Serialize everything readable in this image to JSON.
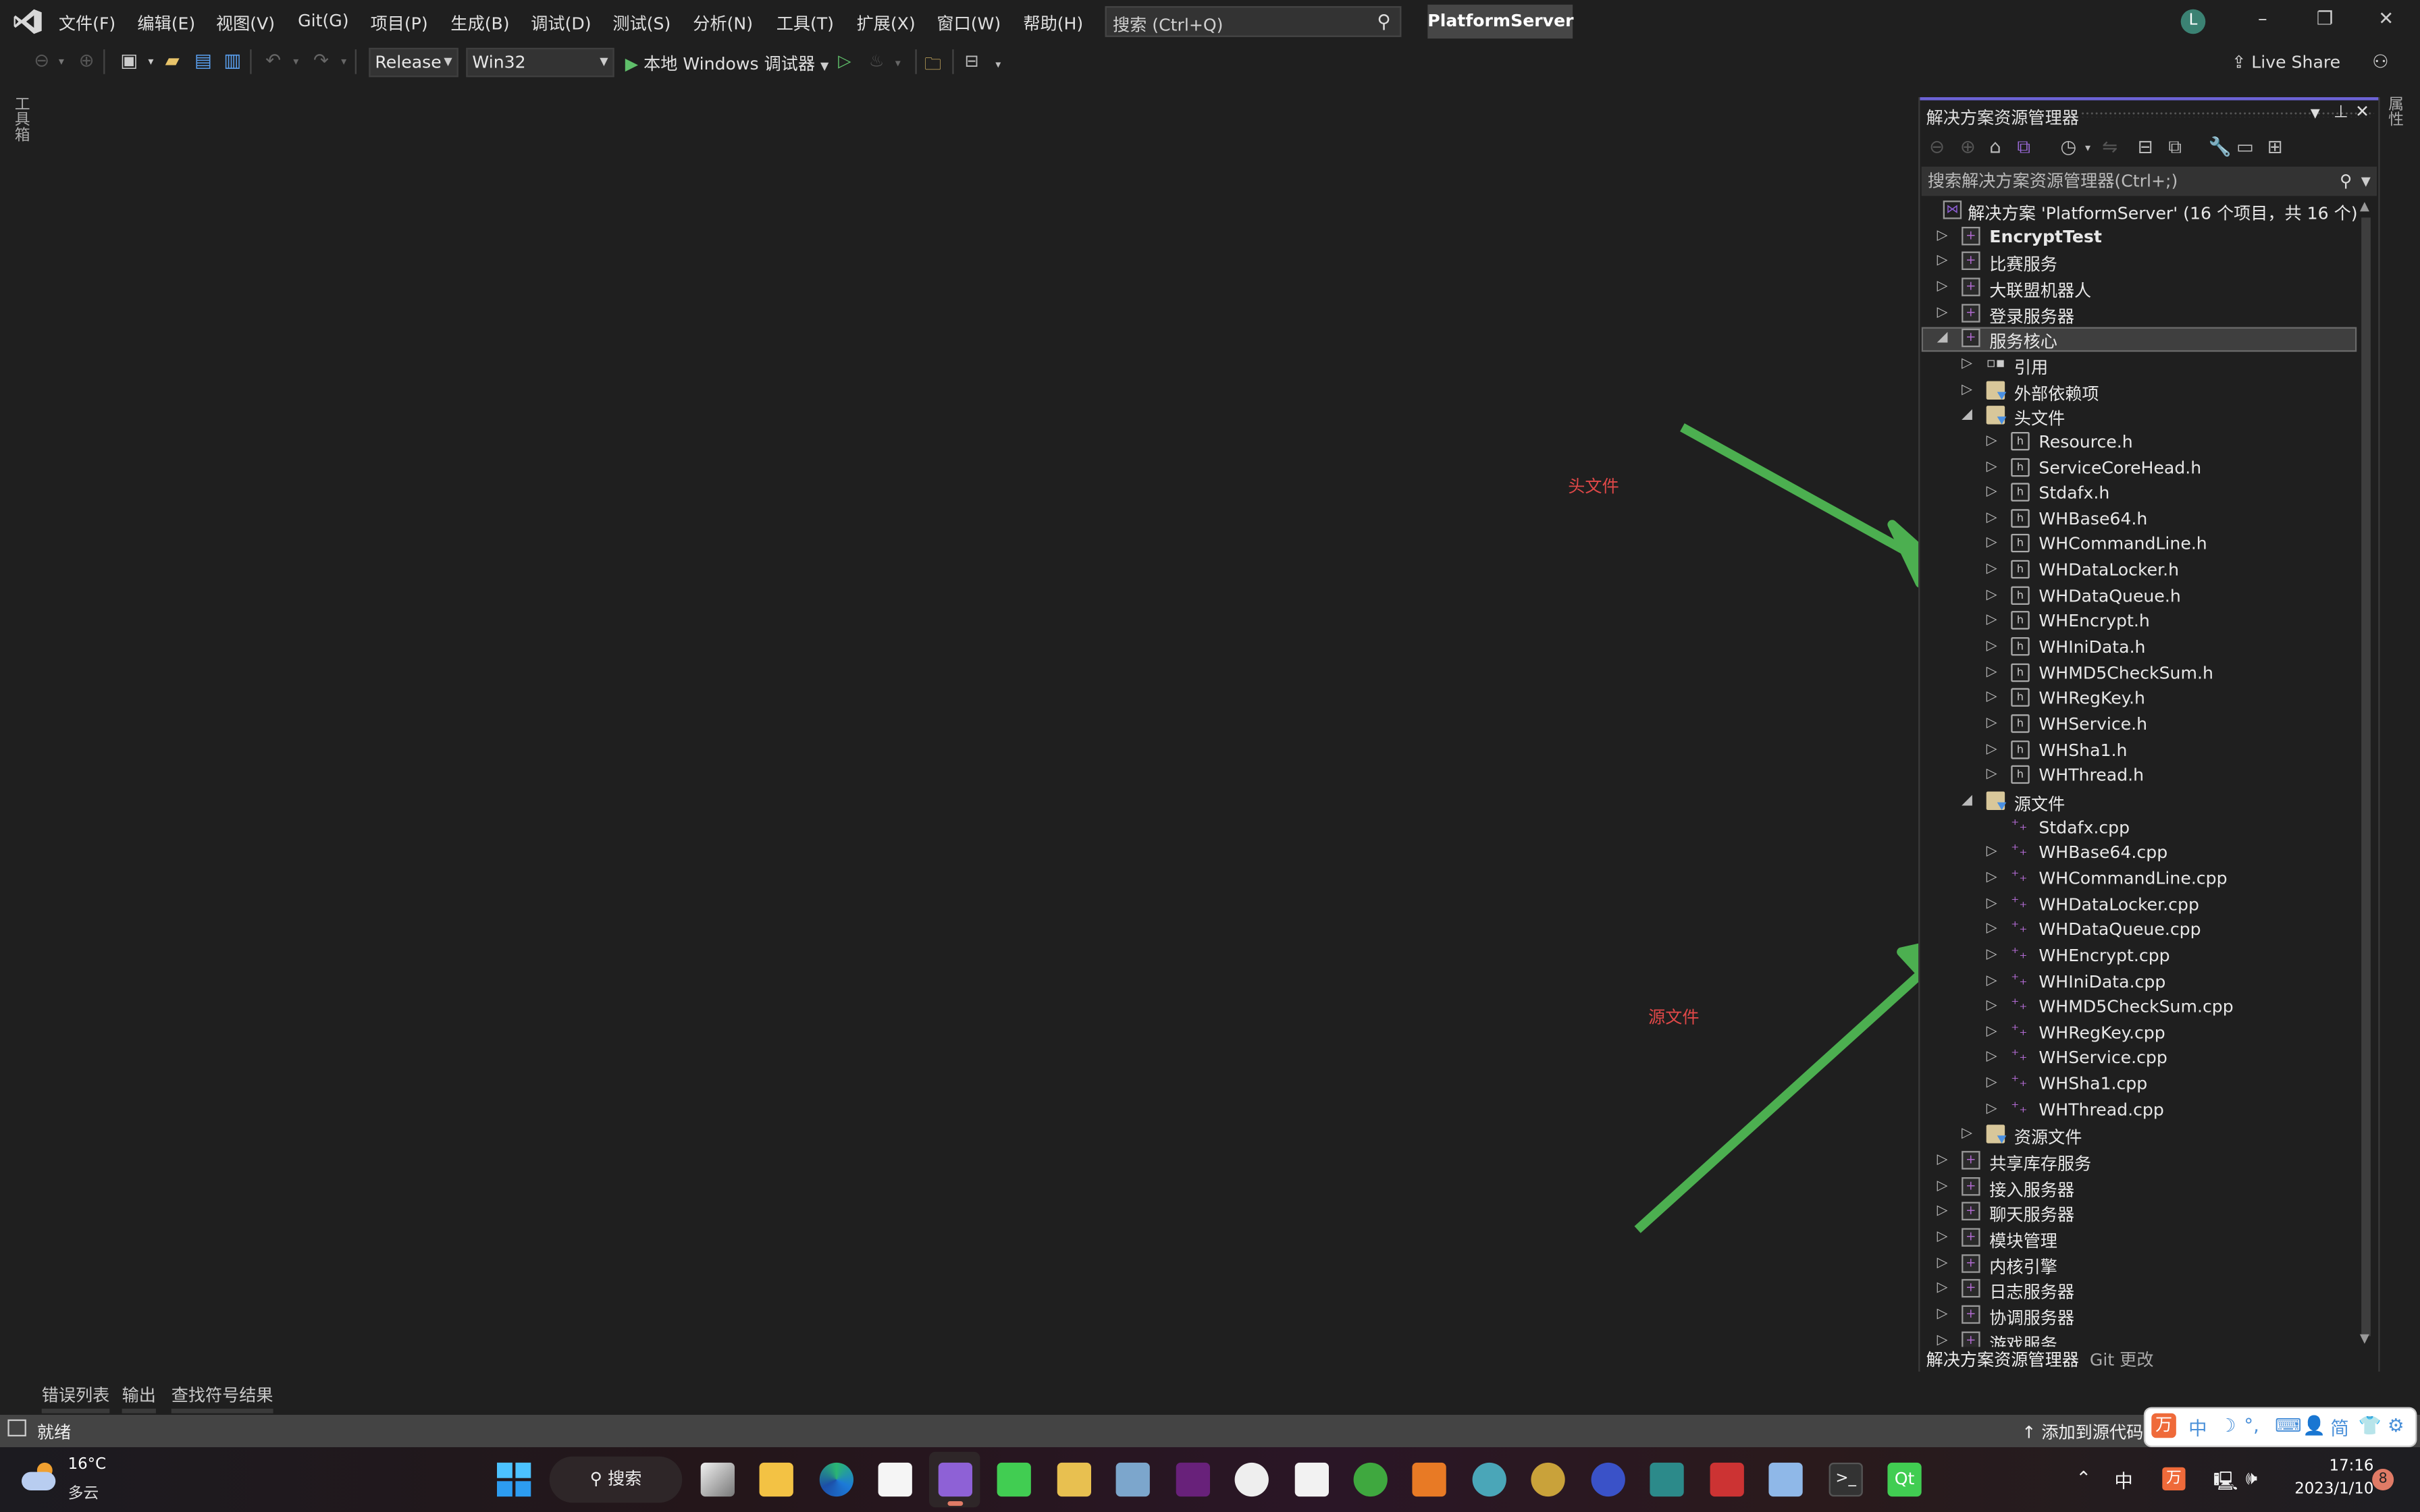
{
  "menubar": {
    "items": [
      "文件(F)",
      "编辑(E)",
      "视图(V)",
      "Git(G)",
      "项目(P)",
      "生成(B)",
      "调试(D)",
      "测试(S)",
      "分析(N)",
      "工具(T)",
      "扩展(X)",
      "窗口(W)",
      "帮助(H)"
    ],
    "search_placeholder": "搜索 (Ctrl+Q)",
    "project_title": "PlatformServer",
    "user_initial": "L",
    "window_controls": {
      "minimize": "–",
      "restore": "❐",
      "close": "✕"
    }
  },
  "toolbar": {
    "configuration": "Release",
    "platform": "Win32",
    "run_label": "本地 Windows 调试器",
    "live_share": "Live Share"
  },
  "side_tabs": {
    "toolbox": "工具箱",
    "properties": "属性"
  },
  "solution_explorer": {
    "title": "解决方案资源管理器",
    "search_placeholder": "搜索解决方案资源管理器(Ctrl+;)",
    "tabs": [
      "解决方案资源管理器",
      "Git 更改"
    ],
    "tree": [
      {
        "label": "解决方案 'PlatformServer' (16 个项目，共 16 个)",
        "type": "solution",
        "depth": 0,
        "toggle": "none"
      },
      {
        "label": "EncryptTest",
        "type": "project",
        "depth": 0,
        "toggle": "collapsed",
        "bold": true
      },
      {
        "label": "比赛服务",
        "type": "project",
        "depth": 0,
        "toggle": "collapsed"
      },
      {
        "label": "大联盟机器人",
        "type": "project",
        "depth": 0,
        "toggle": "collapsed"
      },
      {
        "label": "登录服务器",
        "type": "project",
        "depth": 0,
        "toggle": "collapsed"
      },
      {
        "label": "服务核心",
        "type": "project",
        "depth": 0,
        "toggle": "expanded",
        "selected": true
      },
      {
        "label": "引用",
        "type": "reference",
        "depth": 1,
        "toggle": "collapsed"
      },
      {
        "label": "外部依赖项",
        "type": "folder",
        "depth": 1,
        "toggle": "collapsed"
      },
      {
        "label": "头文件",
        "type": "filter",
        "depth": 1,
        "toggle": "expanded"
      },
      {
        "label": "Resource.h",
        "type": "header",
        "depth": 2,
        "toggle": "collapsed"
      },
      {
        "label": "ServiceCoreHead.h",
        "type": "header",
        "depth": 2,
        "toggle": "collapsed"
      },
      {
        "label": "Stdafx.h",
        "type": "header",
        "depth": 2,
        "toggle": "collapsed"
      },
      {
        "label": "WHBase64.h",
        "type": "header",
        "depth": 2,
        "toggle": "collapsed"
      },
      {
        "label": "WHCommandLine.h",
        "type": "header",
        "depth": 2,
        "toggle": "collapsed"
      },
      {
        "label": "WHDataLocker.h",
        "type": "header",
        "depth": 2,
        "toggle": "collapsed"
      },
      {
        "label": "WHDataQueue.h",
        "type": "header",
        "depth": 2,
        "toggle": "collapsed"
      },
      {
        "label": "WHEncrypt.h",
        "type": "header",
        "depth": 2,
        "toggle": "collapsed"
      },
      {
        "label": "WHIniData.h",
        "type": "header",
        "depth": 2,
        "toggle": "collapsed"
      },
      {
        "label": "WHMD5CheckSum.h",
        "type": "header",
        "depth": 2,
        "toggle": "collapsed"
      },
      {
        "label": "WHRegKey.h",
        "type": "header",
        "depth": 2,
        "toggle": "collapsed"
      },
      {
        "label": "WHService.h",
        "type": "header",
        "depth": 2,
        "toggle": "collapsed"
      },
      {
        "label": "WHSha1.h",
        "type": "header",
        "depth": 2,
        "toggle": "collapsed"
      },
      {
        "label": "WHThread.h",
        "type": "header",
        "depth": 2,
        "toggle": "collapsed"
      },
      {
        "label": "源文件",
        "type": "filter",
        "depth": 1,
        "toggle": "expanded"
      },
      {
        "label": "Stdafx.cpp",
        "type": "cpp",
        "depth": 2,
        "toggle": "none"
      },
      {
        "label": "WHBase64.cpp",
        "type": "cpp",
        "depth": 2,
        "toggle": "collapsed"
      },
      {
        "label": "WHCommandLine.cpp",
        "type": "cpp",
        "depth": 2,
        "toggle": "collapsed"
      },
      {
        "label": "WHDataLocker.cpp",
        "type": "cpp",
        "depth": 2,
        "toggle": "collapsed"
      },
      {
        "label": "WHDataQueue.cpp",
        "type": "cpp",
        "depth": 2,
        "toggle": "collapsed"
      },
      {
        "label": "WHEncrypt.cpp",
        "type": "cpp",
        "depth": 2,
        "toggle": "collapsed"
      },
      {
        "label": "WHIniData.cpp",
        "type": "cpp",
        "depth": 2,
        "toggle": "collapsed"
      },
      {
        "label": "WHMD5CheckSum.cpp",
        "type": "cpp",
        "depth": 2,
        "toggle": "collapsed"
      },
      {
        "label": "WHRegKey.cpp",
        "type": "cpp",
        "depth": 2,
        "toggle": "collapsed"
      },
      {
        "label": "WHService.cpp",
        "type": "cpp",
        "depth": 2,
        "toggle": "collapsed"
      },
      {
        "label": "WHSha1.cpp",
        "type": "cpp",
        "depth": 2,
        "toggle": "collapsed"
      },
      {
        "label": "WHThread.cpp",
        "type": "cpp",
        "depth": 2,
        "toggle": "collapsed"
      },
      {
        "label": "资源文件",
        "type": "filter",
        "depth": 1,
        "toggle": "collapsed"
      },
      {
        "label": "共享库存服务",
        "type": "project",
        "depth": 0,
        "toggle": "collapsed"
      },
      {
        "label": "接入服务器",
        "type": "project",
        "depth": 0,
        "toggle": "collapsed"
      },
      {
        "label": "聊天服务器",
        "type": "project",
        "depth": 0,
        "toggle": "collapsed"
      },
      {
        "label": "模块管理",
        "type": "project",
        "depth": 0,
        "toggle": "collapsed"
      },
      {
        "label": "内核引擎",
        "type": "project",
        "depth": 0,
        "toggle": "collapsed"
      },
      {
        "label": "日志服务器",
        "type": "project",
        "depth": 0,
        "toggle": "collapsed"
      },
      {
        "label": "协调服务器",
        "type": "project",
        "depth": 0,
        "toggle": "collapsed"
      },
      {
        "label": "游戏服务",
        "type": "project",
        "depth": 0,
        "toggle": "collapsed"
      }
    ]
  },
  "annotations": {
    "header_label": "头文件",
    "source_label": "源文件",
    "arrow_color": "#4caf50",
    "label_color": "#e04848"
  },
  "output_tabs": [
    "错误列表",
    "输出",
    "查找符号结果"
  ],
  "statusbar": {
    "ready": "就绪",
    "add_to_source": "添加到源代码管理"
  },
  "ime_bar": [
    "中",
    "☽",
    "°,",
    "⌨",
    "👤",
    "简",
    "👕",
    "⚙"
  ],
  "taskbar": {
    "weather_temp": "16°C",
    "weather_desc": "多云",
    "search_label": "搜索",
    "tray_ime": "中",
    "time": "17:16",
    "date": "2023/1/10",
    "notification_count": "8",
    "apps": [
      "start",
      "task-view",
      "file-explorer",
      "edge",
      "store",
      "visual-studio-2022",
      "qt-creator",
      "tool-1",
      "tool-2",
      "visual-studio",
      "android-studio",
      "snipping-tool",
      "sync-tool",
      "vs-tool",
      "chat",
      "key-tool",
      "webcam",
      "upload-server",
      "network",
      "remote-desktop",
      "terminal",
      "qt"
    ]
  }
}
